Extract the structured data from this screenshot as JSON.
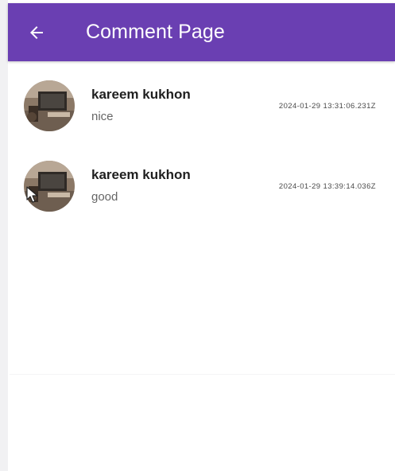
{
  "appbar": {
    "title": "Comment Page",
    "back_icon": "arrow-left-icon",
    "color": "#6a3fb2"
  },
  "comments": [
    {
      "author": "kareem kukhon",
      "text": "nice",
      "timestamp": "2024-01-29 13:31:06.231Z"
    },
    {
      "author": "kareem kukhon",
      "text": "good",
      "timestamp": "2024-01-29 13:39:14.036Z"
    }
  ]
}
